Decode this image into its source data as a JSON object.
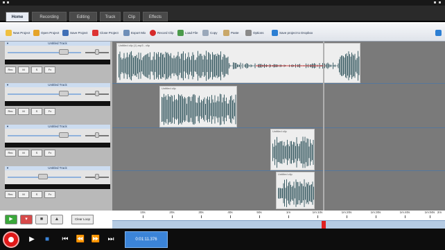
{
  "app": {
    "colors": {
      "accent": "#3b84d8",
      "record": "#e01818",
      "waveform": "#3d5f66",
      "timeline_bg": "#7a7a7a"
    }
  },
  "tabs": [
    {
      "label": "Home",
      "active": true
    },
    {
      "label": "Recording",
      "active": false
    },
    {
      "label": "Editing",
      "active": false
    },
    {
      "label": "Track",
      "active": false
    },
    {
      "label": "Clip",
      "active": false
    },
    {
      "label": "Effects",
      "active": false
    }
  ],
  "toolbar": {
    "new_project": "New Project",
    "open_project": "Open Project",
    "save_project": "Save Project",
    "close_project": "Close Project",
    "export_mix": "Export Mix",
    "record_clip": "Record Clip",
    "load_file": "Load File",
    "copy": "Copy",
    "paste": "Paste",
    "options": "Options",
    "save_to_dropbox": "Save project to Dropbox"
  },
  "tracks": [
    {
      "name": "Untitled Track",
      "buttons": [
        "Rec",
        "M",
        "S",
        "Fx"
      ]
    },
    {
      "name": "Untitled Track",
      "buttons": [
        "Rec",
        "M",
        "S",
        "Fx"
      ]
    },
    {
      "name": "Untitled Track",
      "buttons": [
        "Rec",
        "M",
        "S",
        "Fx"
      ]
    },
    {
      "name": "Untitled Track",
      "buttons": [
        "Rec",
        "M",
        "S",
        "Fx"
      ]
    }
  ],
  "transport_panel": {
    "clear_loop": "Clear Loop"
  },
  "clips": [
    {
      "label": "Untitled clip (1).mp3 - clip"
    },
    {
      "label": "Untitled clip"
    },
    {
      "label": "Untitled clip"
    },
    {
      "label": "Untitled clip"
    }
  ],
  "ruler": {
    "ticks": [
      "10s",
      "20s",
      "30s",
      "40s",
      "50s",
      "1m",
      "1m:10s",
      "1m:20s",
      "1m:30s",
      "1m:40s",
      "1m:50s",
      "2m"
    ]
  },
  "bottom": {
    "time_display": "0:01:11.376"
  }
}
